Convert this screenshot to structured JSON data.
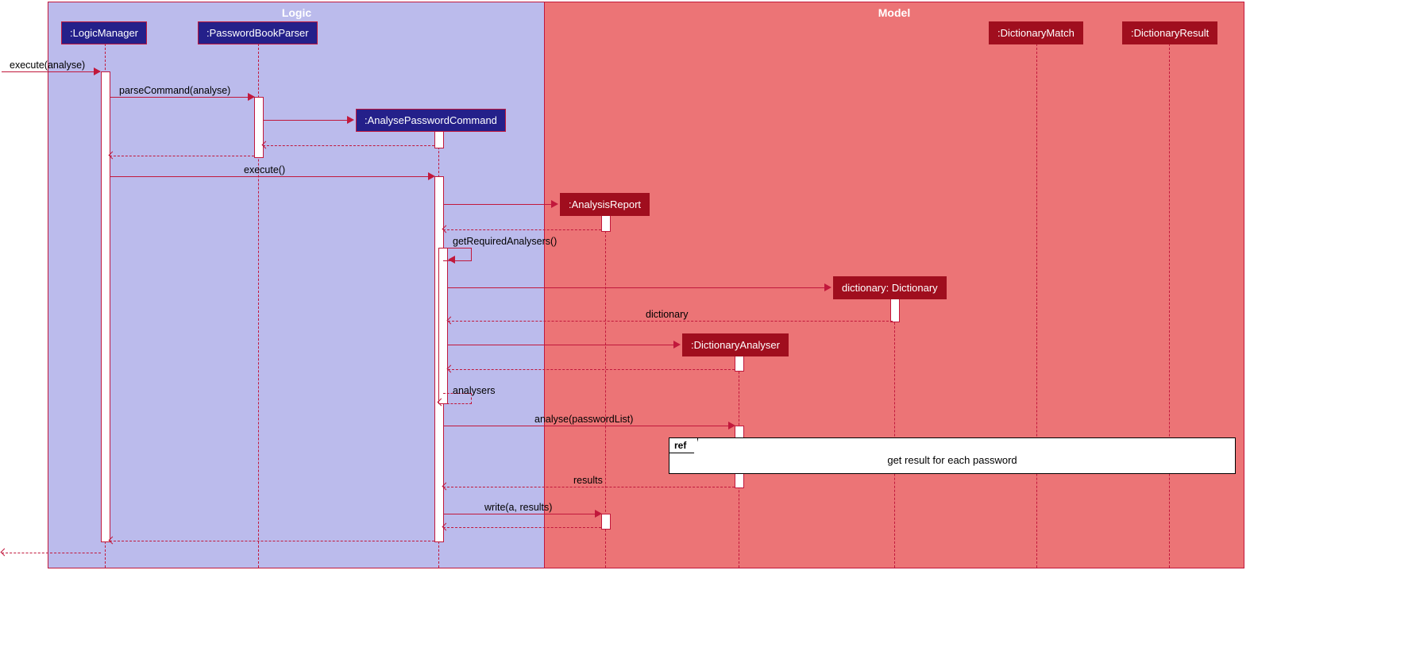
{
  "zones": {
    "logic": "Logic",
    "model": "Model"
  },
  "participants": {
    "logicManager": ":LogicManager",
    "passwordBookParser": ":PasswordBookParser",
    "analysePasswordCommand": ":AnalysePasswordCommand",
    "analysisReport": ":AnalysisReport",
    "dictionary": "dictionary: Dictionary",
    "dictionaryAnalyser": ":DictionaryAnalyser",
    "dictionaryMatch": ":DictionaryMatch",
    "dictionaryResult": ":DictionaryResult"
  },
  "messages": {
    "executeAnalyse": "execute(analyse)",
    "parseCommand": "parseCommand(analyse)",
    "execute": "execute()",
    "getRequiredAnalysers": "getRequiredAnalysers()",
    "dictionaryReturn": "dictionary",
    "analysers": "analysers",
    "analysePasswordList": "analyse(passwordList)",
    "results": "results",
    "writeResults": "write(a, results)"
  },
  "refFrame": {
    "label": "ref",
    "text": "get result for each password"
  }
}
